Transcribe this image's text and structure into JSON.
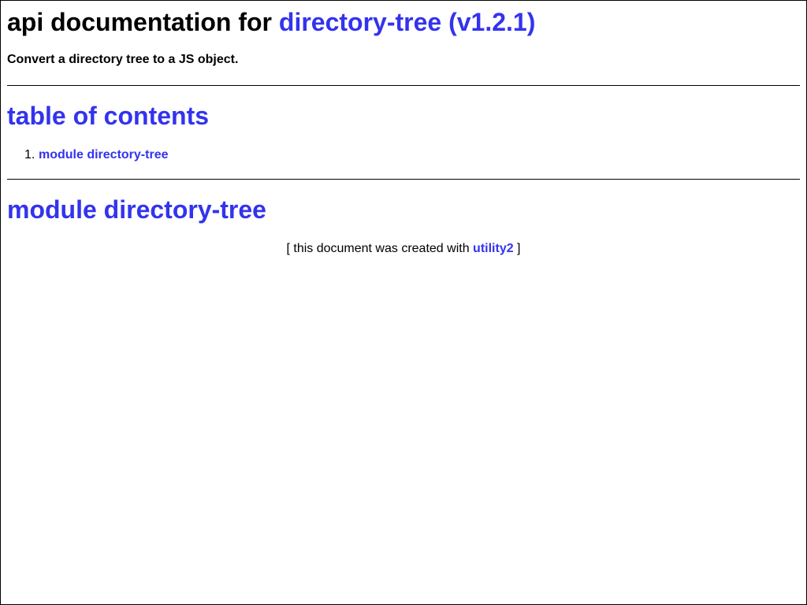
{
  "header": {
    "title_prefix": "api documentation for ",
    "title_link": "directory-tree (v1.2.1)",
    "description": "Convert a directory tree to a JS object."
  },
  "toc": {
    "heading": "table of contents",
    "items": [
      {
        "number": "1.",
        "label": "module directory-tree"
      }
    ]
  },
  "module": {
    "heading": "module directory-tree"
  },
  "footer": {
    "prefix": "[ this document was created with ",
    "link": "utility2",
    "suffix": " ]"
  },
  "colors": {
    "link": "#3333ee",
    "text": "#000000",
    "background": "#ffffff"
  }
}
